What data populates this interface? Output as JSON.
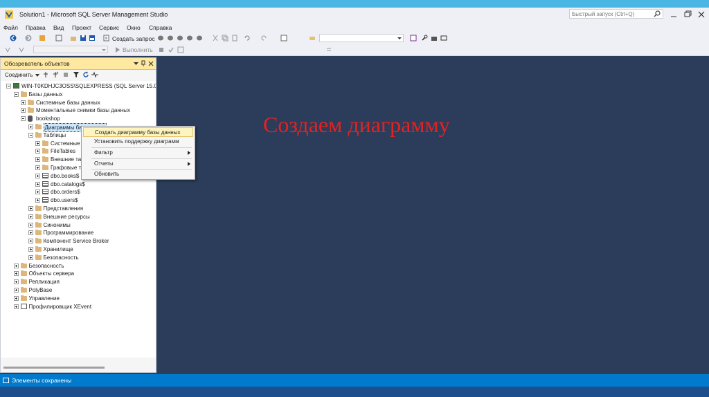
{
  "window": {
    "title": "Solution1 - Microsoft SQL Server Management Studio",
    "quick_launch_placeholder": "Быстрый запуск (Ctrl+Q)"
  },
  "menu": [
    "Файл",
    "Правка",
    "Вид",
    "Проект",
    "Сервис",
    "Окно",
    "Справка"
  ],
  "toolbar": {
    "new_query_label": "Создать запрос",
    "execute_label": "Выполнить"
  },
  "object_explorer": {
    "title": "Обозреватель объектов",
    "connect_label": "Соединить",
    "tree": [
      {
        "label": "WIN-T0KDHJC3OSS\\SQLEXPRESS (SQL Server 15.0.2000",
        "icon": "server-icon",
        "expander": "minus"
      },
      {
        "label": "Базы данных",
        "icon": "folder-icon",
        "expander": "minus"
      },
      {
        "label": "Системные базы данных",
        "icon": "folder-icon",
        "expander": "plus"
      },
      {
        "label": "Моментальные снимки базы данных",
        "icon": "folder-icon",
        "expander": "plus"
      },
      {
        "label": "bookshop",
        "icon": "database-icon",
        "expander": "minus"
      },
      {
        "label": "Диаграммы баз данных",
        "icon": "folder-icon",
        "expander": "plus",
        "selected": true
      },
      {
        "label": "Таблицы",
        "icon": "folder-icon",
        "expander": "minus"
      },
      {
        "label": "Системные т",
        "icon": "folder-icon",
        "expander": "plus"
      },
      {
        "label": "FileTables",
        "icon": "folder-icon",
        "expander": "plus"
      },
      {
        "label": "Внешние таб",
        "icon": "folder-icon",
        "expander": "plus"
      },
      {
        "label": "Графовые та",
        "icon": "folder-icon",
        "expander": "plus"
      },
      {
        "label": "dbo.books$",
        "icon": "table-icon",
        "expander": "plus"
      },
      {
        "label": "dbo.catalogs$",
        "icon": "table-icon",
        "expander": "plus"
      },
      {
        "label": "dbo.orders$",
        "icon": "table-icon",
        "expander": "plus"
      },
      {
        "label": "dbo.users$",
        "icon": "table-icon",
        "expander": "plus"
      },
      {
        "label": "Представления",
        "icon": "folder-icon",
        "expander": "plus"
      },
      {
        "label": "Внешние ресурсы",
        "icon": "folder-icon",
        "expander": "plus"
      },
      {
        "label": "Синонимы",
        "icon": "folder-icon",
        "expander": "plus"
      },
      {
        "label": "Программирование",
        "icon": "folder-icon",
        "expander": "plus"
      },
      {
        "label": "Компонент Service Broker",
        "icon": "folder-icon",
        "expander": "plus"
      },
      {
        "label": "Хранилище",
        "icon": "folder-icon",
        "expander": "plus"
      },
      {
        "label": "Безопасность",
        "icon": "folder-icon",
        "expander": "plus"
      },
      {
        "label": "Безопасность",
        "icon": "folder-icon",
        "expander": "plus"
      },
      {
        "label": "Объекты сервера",
        "icon": "folder-icon",
        "expander": "plus"
      },
      {
        "label": "Репликация",
        "icon": "folder-icon",
        "expander": "plus"
      },
      {
        "label": "PolyBase",
        "icon": "folder-icon",
        "expander": "plus"
      },
      {
        "label": "Управление",
        "icon": "folder-icon",
        "expander": "plus"
      },
      {
        "label": "Профилировщик XEvent",
        "icon": "xevent-icon",
        "expander": "plus"
      }
    ]
  },
  "context_menu": {
    "items": [
      {
        "label": "Создать диаграмму базы данных",
        "highlighted": true
      },
      {
        "label": "Установить поддержку диаграмм"
      },
      {
        "label": "Фильтр",
        "submenu": true
      },
      {
        "label": "Отчеты",
        "submenu": true
      },
      {
        "label": "Обновить"
      }
    ]
  },
  "slide_title": "Создаем диаграмму",
  "status": "Элементы сохранены",
  "colors": {
    "accent": "#007acc",
    "doc_background": "#2b3d5a",
    "slide_title": "#e32222",
    "oe_header": "#ffe9a1",
    "selection": "#cce8ff"
  }
}
